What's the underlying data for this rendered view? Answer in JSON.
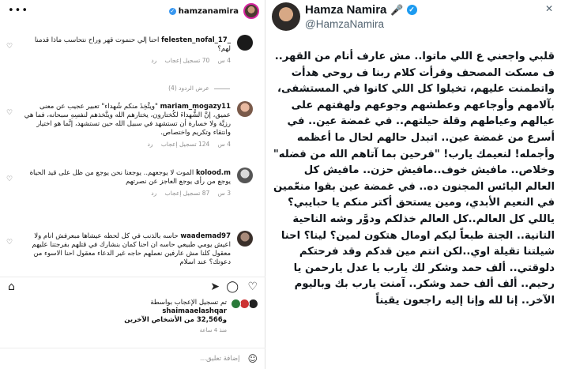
{
  "instagram": {
    "username": "hamzanamira",
    "comments": [
      {
        "user": "felesten_nofal_17_",
        "text": "احنا إلي حنموت قهر وراح نتحاسب ماذا قدمنا لهم؟",
        "time": "4 س",
        "likes": "70 تسجيل إعجاب",
        "reply": "رد"
      },
      {
        "user": "mariam_mogazy11",
        "text": "\"ويتَّخِذَ منكم شُهداء\" تعبير عجيب عن معنى عميق، إنَّ الشُّهداءَ لكُختارون، يختارهم الله ويتَّخذهم لنفسِهِ سبحانه، فما هي رزيَّة ولا خسارة أن تستشهد في سبيل الله حين تستشهد، إنَّما هو اختيار وانتقاء وتكريم واختصاص.",
        "time": "4 س",
        "likes": "124 تسجيل إعجاب",
        "reply": "رد"
      },
      {
        "user": "kolood.m",
        "text": "الموت لا يوجعهم.. يوجعنا نحن يوجع من ظل على قيد الحياة يوجع من رأى يوجع العاجز عن نصرتهم",
        "time": "3 س",
        "likes": "87 تسجيل إعجاب",
        "reply": "رد"
      },
      {
        "user": "waademad97",
        "text": "حاسه بالذنب في كل لحظه عيشاها مبعرفش انام ولا اعيش يومي طبيعي حاسه ان احنا كمان بنشارك في قتلهم بفرجتنا عليهم معقول كلنا مش عارفين نعملهم حاجه غير الدعاء معقول احنا الاسوء من دعوتك؟ عند اسلام",
        "time": "",
        "likes": "",
        "reply": ""
      }
    ],
    "replies_toggle": "عرض الردود (4)",
    "likes_line1_prefix": "تم تسجيل الإعجاب بواسطة",
    "likes_user": "shaimaaelashqar",
    "likes_line2": "و32,566 من الأشخاص الآخرين",
    "post_time": "منذ 4 ساعة",
    "add_comment_placeholder": "إضافة تعليق..."
  },
  "tweet": {
    "name": "Hamza Namira",
    "handle": "@HamzaNamira",
    "body": "قلبي واجعني ع اللي ماتوا.. مش عارف أنام من القهر.. ف مسكت المصحف وقرأت كلام ربنا ف روحي هدأت واتطمنت عليهم، تخيلوا كل اللي كانوا في المستشفى، بآلامهم وأوجاعهم وعطشهم وجوعهم ولهفتهم على عيالهم وعياطهم وقلة حيلتهم.. في غمضة عين.. في أسرع من غمضة عين.. اتبدل حالهم لحال ما أعظمه وأجمله! لنعيمك يارب! \"فرحين بما آتاهم الله من فضله\" وخلاص.. مافيش خوف..مافيش حزن.. مافيش كل العالم البائس المجنون ده.. في غمضة عين بقوا منعّمين في النعيم الأبدي، ومين يستحق أكتر منكم يا حبايبي؟ ياللي كل العالم..كل العالم خذلكم ودوَّر وشه الناحية التانية.. الجنة طبعاً ليكم اومال هتكون لمين؟ لينا؟ احنا شيلتنا تقيلة اوي..لكن انتم مين قدكم وقد فرحتكم دلوقتي.. ألف حمد وشكر لك يارب يا عدل يارحمن يا رحيم.. ألف ألف حمد وشكر.. آمنت يارب بك وباليوم الآخر.. إنا لله وإنا إليه راجعون يقيناً"
  },
  "icons": {
    "more": "more-dots-icon",
    "verified": "verified-badge-icon",
    "heart": "heart-icon",
    "comment": "comment-icon",
    "share": "share-icon",
    "bookmark": "bookmark-icon",
    "emoji": "emoji-icon",
    "mic": "microphone-icon",
    "close": "close-icon"
  },
  "colors": {
    "verified_blue": "#1d9bf0",
    "instagram_gray": "#8e8e8e"
  }
}
